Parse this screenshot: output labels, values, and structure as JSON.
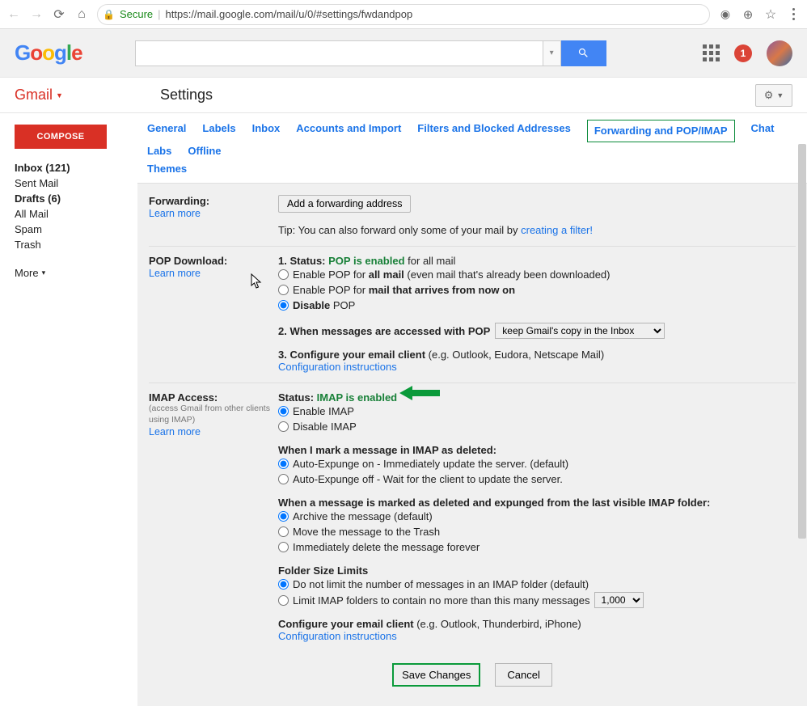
{
  "chrome": {
    "secure_label": "Secure",
    "url": "https://mail.google.com/mail/u/0/#settings/fwdandpop"
  },
  "header": {
    "logo_letters": [
      "G",
      "o",
      "o",
      "g",
      "l",
      "e"
    ],
    "notif_count": "1"
  },
  "sub": {
    "gmail_label": "Gmail",
    "settings_title": "Settings"
  },
  "sidebar": {
    "compose": "COMPOSE",
    "items": [
      "Inbox (121)",
      "Sent Mail",
      "Drafts (6)",
      "All Mail",
      "Spam",
      "Trash"
    ],
    "more": "More"
  },
  "tabs": [
    "General",
    "Labels",
    "Inbox",
    "Accounts and Import",
    "Filters and Blocked Addresses",
    "Forwarding and POP/IMAP",
    "Chat",
    "Labs",
    "Offline",
    "Themes"
  ],
  "active_tab_index": 5,
  "fwd": {
    "label": "Forwarding:",
    "learn": "Learn more",
    "add_btn": "Add a forwarding address",
    "tip_prefix": "Tip: You can also forward only some of your mail by ",
    "tip_link": "creating a filter!"
  },
  "pop": {
    "label": "POP Download:",
    "learn": "Learn more",
    "line1_prefix": "1. Status: ",
    "line1_status": "POP is enabled",
    "line1_suffix": " for all mail",
    "opt1_prefix": "Enable POP for ",
    "opt1_bold": "all mail",
    "opt1_suffix": " (even mail that's already been downloaded)",
    "opt2_prefix": "Enable POP for ",
    "opt2_bold": "mail that arrives from now on",
    "opt3_prefix": "Disable",
    "opt3_suffix": " POP",
    "line2": "2. When messages are accessed with POP",
    "sel2": "keep Gmail's copy in the Inbox",
    "line3_prefix": "3. Configure your email client ",
    "line3_suffix": "(e.g. Outlook, Eudora, Netscape Mail)",
    "conf_link": "Configuration instructions"
  },
  "imap": {
    "label": "IMAP Access:",
    "hint": "(access Gmail from other clients using IMAP)",
    "learn": "Learn more",
    "status_prefix": "Status: ",
    "status": "IMAP is enabled",
    "enable": "Enable IMAP",
    "disable": "Disable IMAP",
    "del_title": "When I mark a message in IMAP as deleted:",
    "del_opt1": "Auto-Expunge on - Immediately update the server. (default)",
    "del_opt2": "Auto-Expunge off - Wait for the client to update the server.",
    "exp_title": "When a message is marked as deleted and expunged from the last visible IMAP folder:",
    "exp_opt1": "Archive the message (default)",
    "exp_opt2": "Move the message to the Trash",
    "exp_opt3": "Immediately delete the message forever",
    "folder_title": "Folder Size Limits",
    "folder_opt1": "Do not limit the number of messages in an IMAP folder (default)",
    "folder_opt2": "Limit IMAP folders to contain no more than this many messages",
    "folder_sel": "1,000",
    "conf_prefix": "Configure your email client ",
    "conf_suffix": "(e.g. Outlook, Thunderbird, iPhone)",
    "conf_link": "Configuration instructions"
  },
  "footer": {
    "save": "Save Changes",
    "cancel": "Cancel"
  }
}
